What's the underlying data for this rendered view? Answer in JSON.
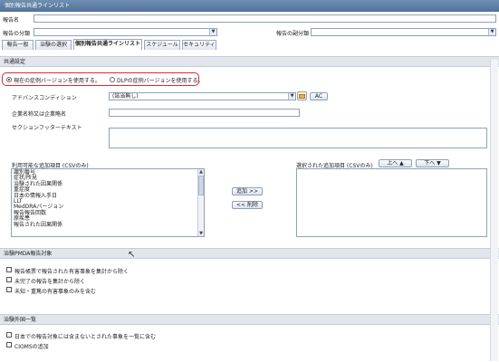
{
  "window": {
    "title": "個別報告共通ラインリスト"
  },
  "header": {
    "report_name_label": "報告名",
    "report_category_label": "報告の分類",
    "report_subcategory_label": "報告の副分類"
  },
  "tabs": [
    {
      "label": "報告一般"
    },
    {
      "label": "治験の選択"
    },
    {
      "label": "個別報告共通ラインリスト"
    },
    {
      "label": "スケジュール"
    },
    {
      "label": "セキュリティ"
    }
  ],
  "common": {
    "section_title": "共通設定",
    "radio_current": "現在の症例バージョンを使用する。",
    "radio_dlp": "DLPの症例バージョンを使用する。",
    "advanced_condition_label": "アドバンスコンディション",
    "advanced_condition_value": "(該当無し)",
    "ac_button": "AC",
    "company_name_label": "企業名称又は企業略名",
    "section_footer_label": "セクションフッターテキスト"
  },
  "fields": {
    "available_label": "利用可能な追加項目 (CSVのみ)",
    "available_items": [
      "識別番号",
      "症状/所見",
      "治験された因果関係",
      "重症度",
      "日本の情報入手日",
      "LLT",
      "MedDRAバージョン",
      "報告報告回数",
      "原疾患",
      "報告された因果関係"
    ],
    "add_button": "追加 >>",
    "remove_button": "<< 削除",
    "selected_label": "選択された追加項目 (CSVのみ)",
    "up_button": "上へ",
    "down_button": "下へ"
  },
  "pmda": {
    "section_title": "治験PMDA報告対象",
    "checks": [
      "報告帳票で報告された有害事象を集計から除く",
      "未完了の報告を集計から除く",
      "未知・重篤の有害事象のみを含む"
    ]
  },
  "foreign": {
    "section_title": "治験外国一覧",
    "checks": [
      "日本での報告対象には含まないとされた事象を一覧に含む",
      "CIOMSの追加"
    ]
  }
}
